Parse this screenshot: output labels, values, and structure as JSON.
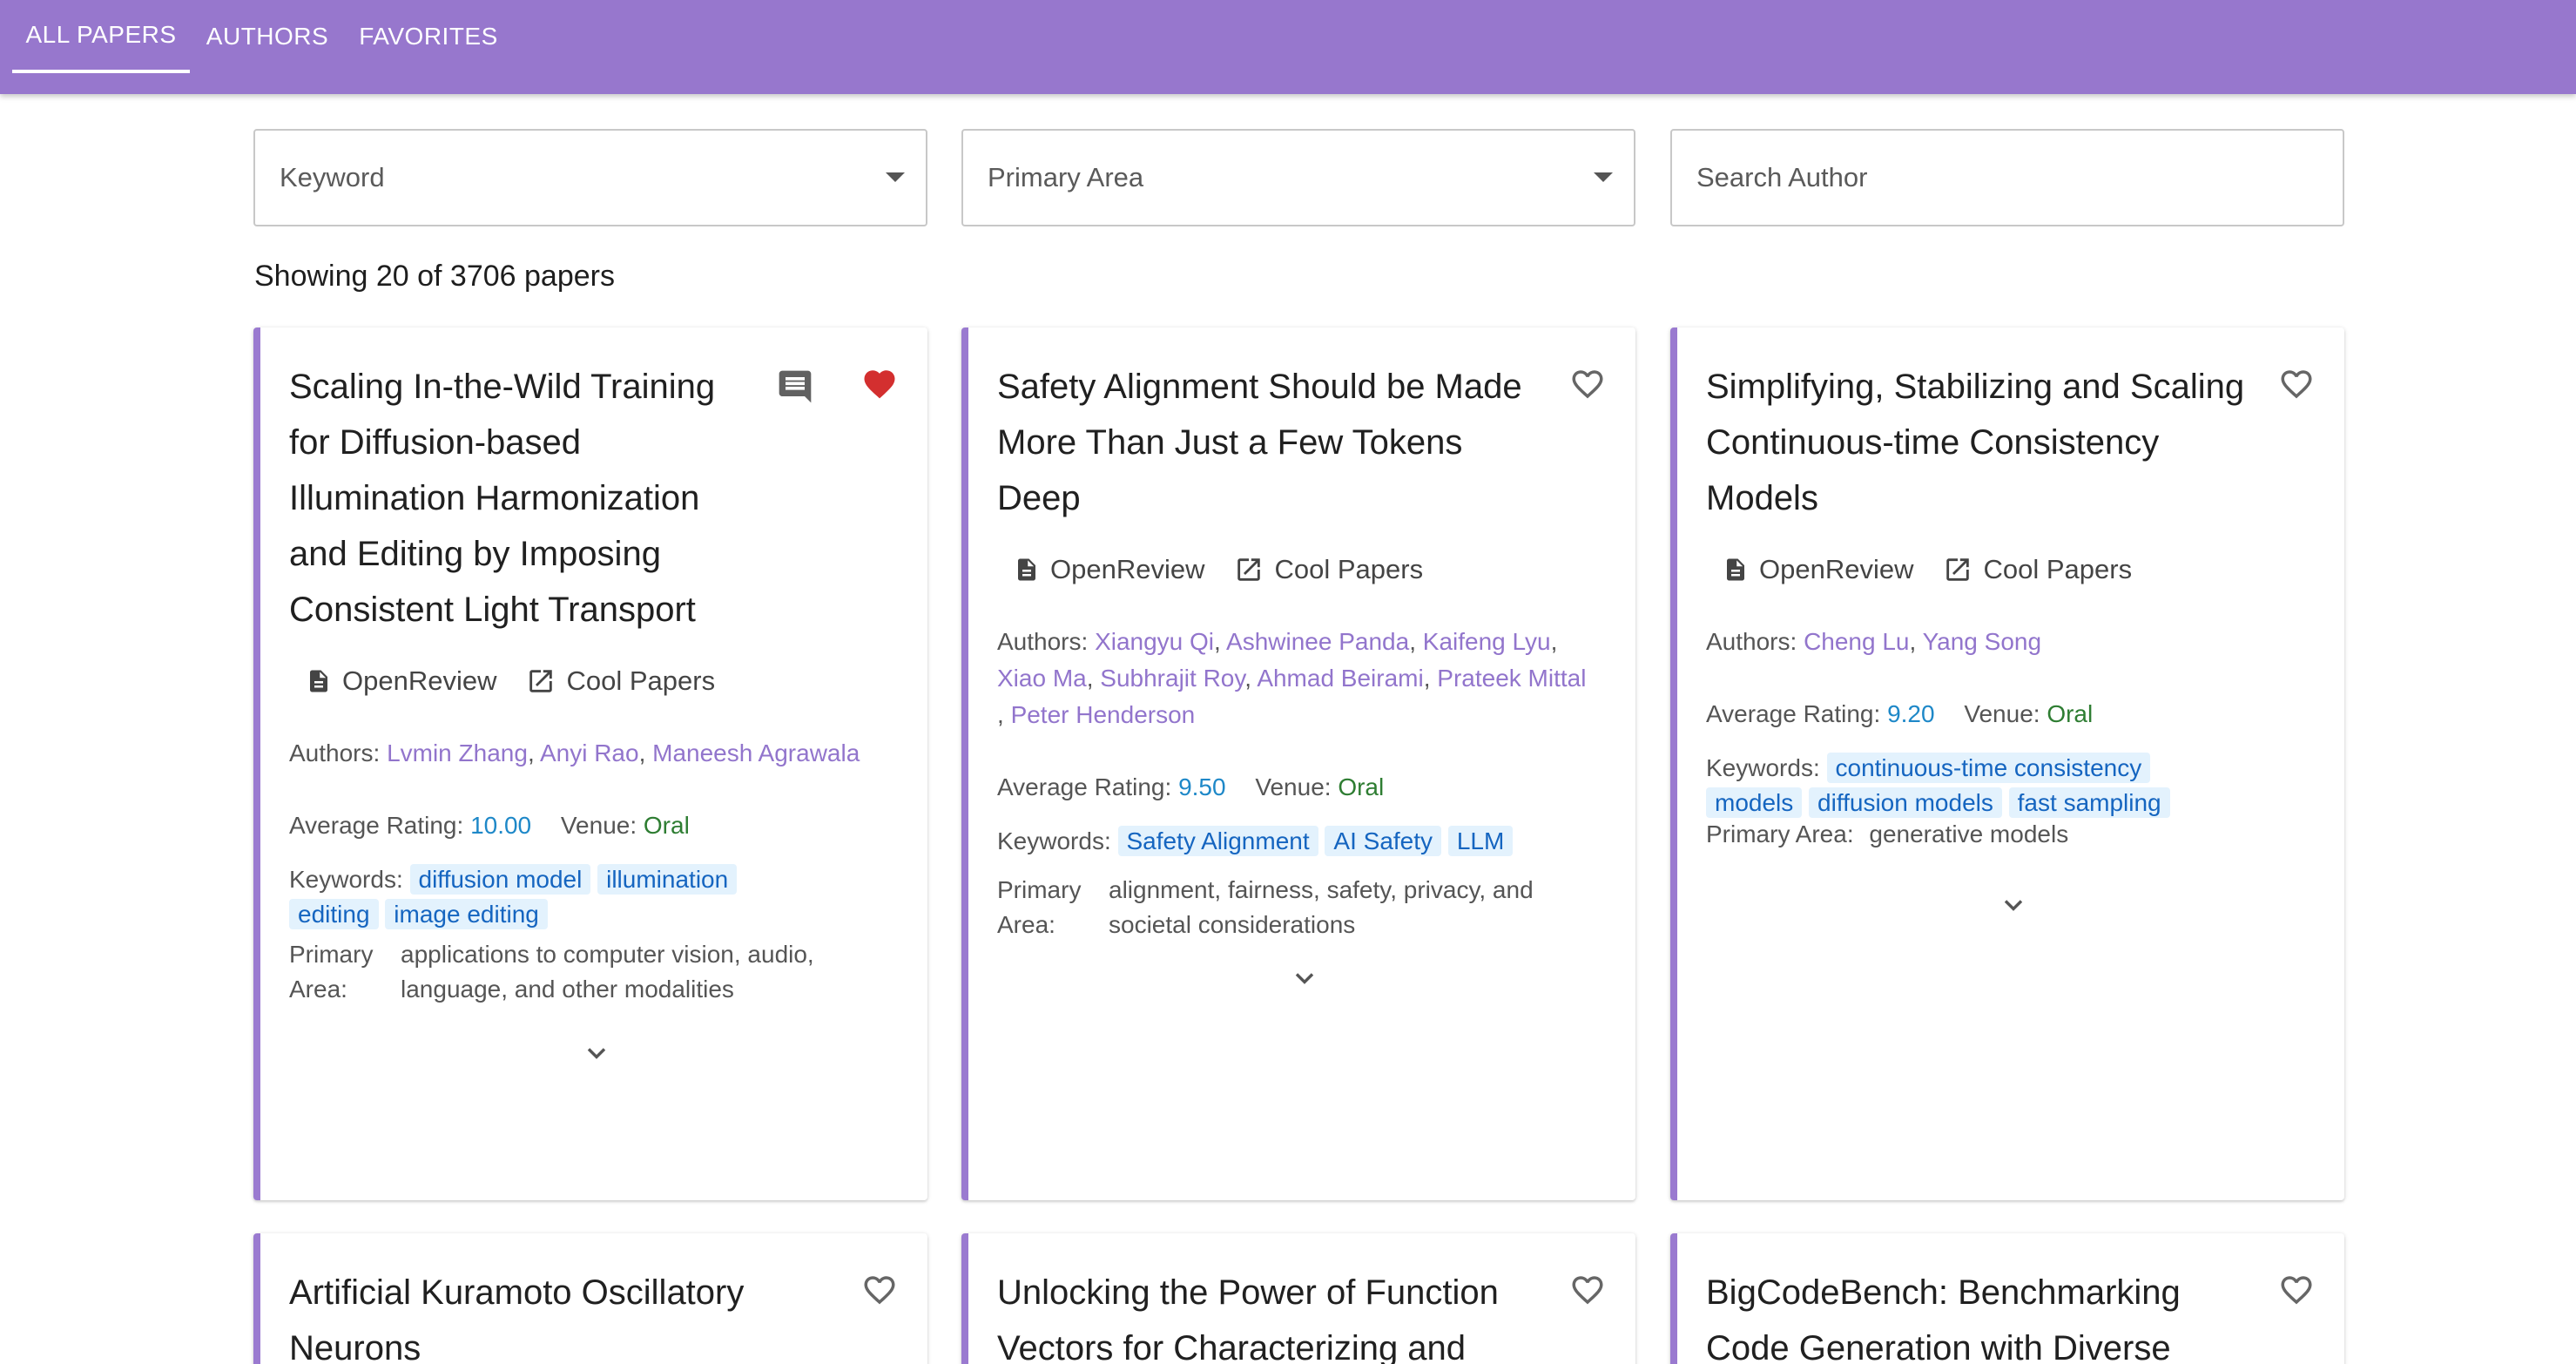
{
  "nav": {
    "tabs": [
      {
        "label": "ALL PAPERS",
        "active": true
      },
      {
        "label": "AUTHORS",
        "active": false
      },
      {
        "label": "FAVORITES",
        "active": false
      }
    ]
  },
  "filters": {
    "keyword_placeholder": "Keyword",
    "primary_area_placeholder": "Primary Area",
    "author_placeholder": "Search Author"
  },
  "result_count": "Showing 20 of 3706 papers",
  "labels": {
    "openreview": "OpenReview",
    "cool_papers": "Cool Papers",
    "authors": "Authors:",
    "average_rating": "Average Rating:",
    "venue": "Venue:",
    "keywords": "Keywords:",
    "primary": "Primary",
    "area": "Area:",
    "primary_area": "Primary Area:"
  },
  "colors": {
    "header": "#9777cd",
    "card_accent": "#9a7ad0",
    "author_link": "#9275cc",
    "rating": "#1e88c8",
    "venue": "#2e7d32",
    "chip_bg": "#e3f2fd",
    "chip_text": "#1565c0",
    "heart_filled": "#d32f2f"
  },
  "papers": [
    {
      "title": "Scaling In-the-Wild Training for Diffusion-based Illumination Harmonization and Editing by Imposing Consistent Light Transport",
      "favorited": true,
      "has_comment": true,
      "authors": [
        "Lvmin Zhang",
        "Anyi Rao",
        "Maneesh Agrawala"
      ],
      "rating": "10.00",
      "venue": "Oral",
      "keywords": [
        "diffusion model",
        "illumination editing",
        "image editing"
      ],
      "primary_area": "applications to computer vision, audio, language, and other modalities"
    },
    {
      "title": "Safety Alignment Should be Made More Than Just a Few Tokens Deep",
      "favorited": false,
      "authors": [
        "Xiangyu Qi",
        "Ashwinee Panda",
        "Kaifeng Lyu",
        "Xiao Ma",
        "Subhrajit Roy",
        "Ahmad Beirami",
        "Prateek Mittal",
        "Peter Henderson"
      ],
      "rating": "9.50",
      "venue": "Oral",
      "keywords": [
        "Safety Alignment",
        "AI Safety",
        "LLM"
      ],
      "primary_area": "alignment, fairness, safety, privacy, and societal considerations"
    },
    {
      "title": "Simplifying, Stabilizing and Scaling Continuous-time Consistency Models",
      "favorited": false,
      "authors": [
        "Cheng Lu",
        "Yang Song"
      ],
      "rating": "9.20",
      "venue": "Oral",
      "keywords": [
        "continuous-time consistency models",
        "diffusion models",
        "fast sampling"
      ],
      "primary_area": "generative models"
    },
    {
      "title": "Artificial Kuramoto Oscillatory Neurons",
      "favorited": false
    },
    {
      "title": "Unlocking the Power of Function Vectors for Characterizing and",
      "favorited": false
    },
    {
      "title": "BigCodeBench: Benchmarking Code Generation with Diverse",
      "favorited": false
    }
  ]
}
